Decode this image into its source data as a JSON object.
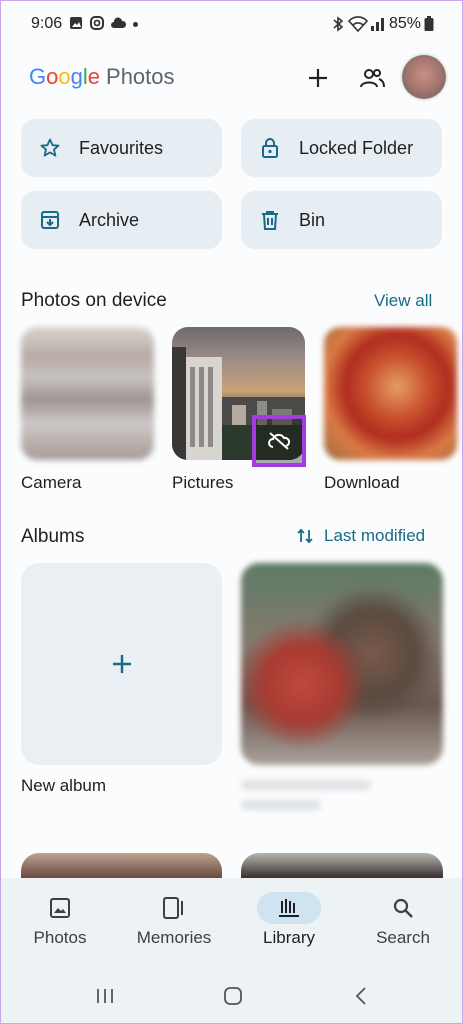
{
  "status_bar": {
    "time": "9:06",
    "battery": "85%"
  },
  "header": {
    "logo_google": [
      "G",
      "o",
      "o",
      "g",
      "l",
      "e"
    ],
    "logo_product": "Photos",
    "add_icon": "plus-icon",
    "sharing_icon": "people-icon"
  },
  "quick_access": [
    {
      "label": "Favourites",
      "icon": "star-icon"
    },
    {
      "label": "Locked Folder",
      "icon": "lock-icon"
    },
    {
      "label": "Archive",
      "icon": "archive-icon"
    },
    {
      "label": "Bin",
      "icon": "trash-icon"
    }
  ],
  "photos_on_device": {
    "title": "Photos on device",
    "view_all": "View all",
    "folders": [
      {
        "label": "Camera"
      },
      {
        "label": "Pictures",
        "badge_icon": "cloud-off-icon"
      },
      {
        "label": "Download"
      }
    ]
  },
  "albums": {
    "title": "Albums",
    "sort_label": "Last modified",
    "new_album_label": "New album"
  },
  "bottom_nav": [
    {
      "label": "Photos",
      "icon": "photo-icon",
      "active": false
    },
    {
      "label": "Memories",
      "icon": "memories-icon",
      "active": false
    },
    {
      "label": "Library",
      "icon": "library-icon",
      "active": true
    },
    {
      "label": "Search",
      "icon": "search-icon",
      "active": false
    }
  ],
  "colors": {
    "accent": "#1a6a86",
    "highlight_border": "#a23be0",
    "nav_active_pill": "#cfe3f0"
  }
}
